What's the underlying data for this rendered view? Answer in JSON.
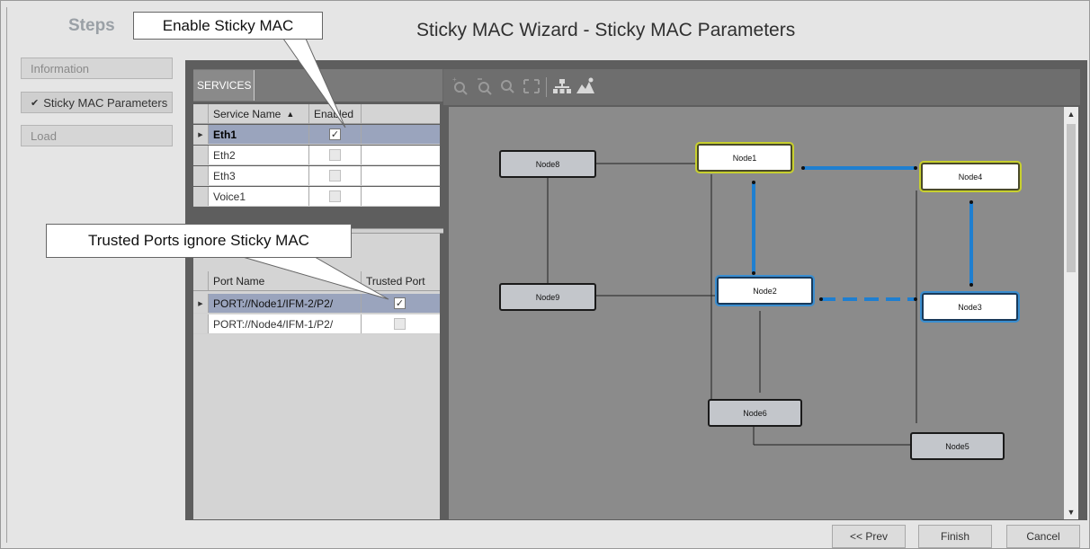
{
  "steps": {
    "title": "Steps",
    "items": [
      {
        "label": "Information"
      },
      {
        "label": "Sticky MAC Parameters",
        "check": "✔"
      },
      {
        "label": "Load"
      }
    ]
  },
  "wizard_title": "Sticky MAC Wizard - Sticky MAC Parameters",
  "services": {
    "tab": "SERVICES",
    "columns": {
      "name": "Service Name",
      "sort": "▲",
      "enabled": "Enabled"
    },
    "rows": [
      {
        "name": "Eth1",
        "enabled": true,
        "selected": true
      },
      {
        "name": "Eth2",
        "enabled": false
      },
      {
        "name": "Eth3",
        "enabled": false
      },
      {
        "name": "Voice1",
        "enabled": false
      }
    ]
  },
  "ports": {
    "columns": {
      "name": "Port Name",
      "trusted": "Trusted Port"
    },
    "rows": [
      {
        "name": "PORT://Node1/IFM-2/P2/",
        "trusted": true,
        "selected": true
      },
      {
        "name": "PORT://Node4/IFM-1/P2/",
        "trusted": false
      }
    ]
  },
  "toolbar": {
    "icons": [
      "zoom-in-icon",
      "zoom-out-icon",
      "fit-screen-icon",
      "hierarchy-layout-icon",
      "image-export-icon"
    ]
  },
  "topology": {
    "nodes": {
      "node8": "Node8",
      "node1": "Node1",
      "node4": "Node4",
      "node9": "Node9",
      "node2": "Node2",
      "node3": "Node3",
      "node6": "Node6",
      "node5": "Node5"
    }
  },
  "callouts": {
    "sticky": "Enable Sticky MAC",
    "trusted": "Trusted Ports ignore Sticky MAC"
  },
  "buttons": {
    "prev": "<< Prev",
    "finish": "Finish",
    "cancel": "Cancel"
  },
  "colors": {
    "link_blue": "#1f7fd0",
    "highlight_yellow": "#c8d02e",
    "selected_row": "#9aa4bd"
  }
}
